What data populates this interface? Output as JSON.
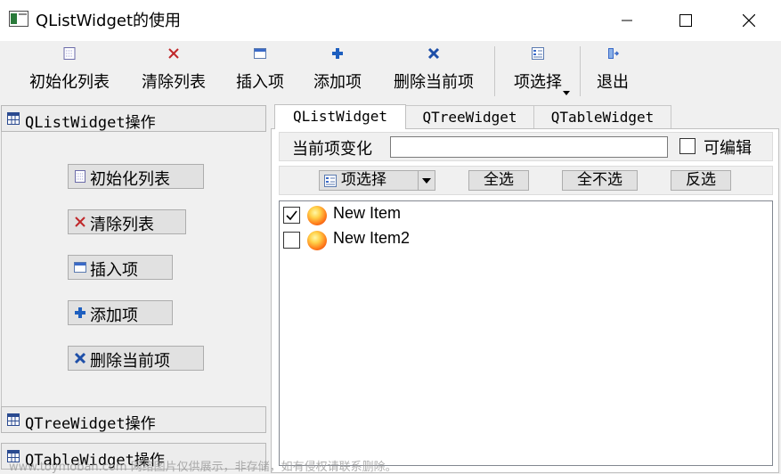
{
  "window": {
    "title": "QListWidget的使用",
    "minimize": "minimize",
    "maximize": "maximize",
    "close": "close"
  },
  "toolbar": {
    "init_list": "初始化列表",
    "clear_list": "清除列表",
    "insert_item": "插入项",
    "add_item": "添加项",
    "delete_item": "删除当前项",
    "select_items": "项选择",
    "exit": "退出"
  },
  "toolbox": {
    "page1_title": "QListWidget操作",
    "page2_title": "QTreeWidget操作",
    "page3_title": "QTableWidget操作",
    "buttons": {
      "init_list": "初始化列表",
      "clear_list": "清除列表",
      "insert_item": "插入项",
      "add_item": "添加项",
      "delete_item": "删除当前项"
    }
  },
  "tabs": {
    "tab1": "QListWidget",
    "tab2": "QTreeWidget",
    "tab3": "QTableWidget"
  },
  "current_item": {
    "label": "当前项变化",
    "value": "",
    "editable_label": "可编辑",
    "editable_checked": false
  },
  "selection": {
    "select_button": "项选择",
    "select_all": "全选",
    "select_none": "全不选",
    "select_invert": "反选"
  },
  "list": {
    "items": [
      {
        "text": "New Item",
        "checked": true
      },
      {
        "text": "New Item2",
        "checked": false
      }
    ]
  },
  "watermark": "www.toymoban.com 网络图片仅供展示，非存储，如有侵权请联系删除。",
  "colors": {
    "accent_blue": "#1e5fbf",
    "delete_red": "#c0282a",
    "background": "#f0f0f0"
  }
}
